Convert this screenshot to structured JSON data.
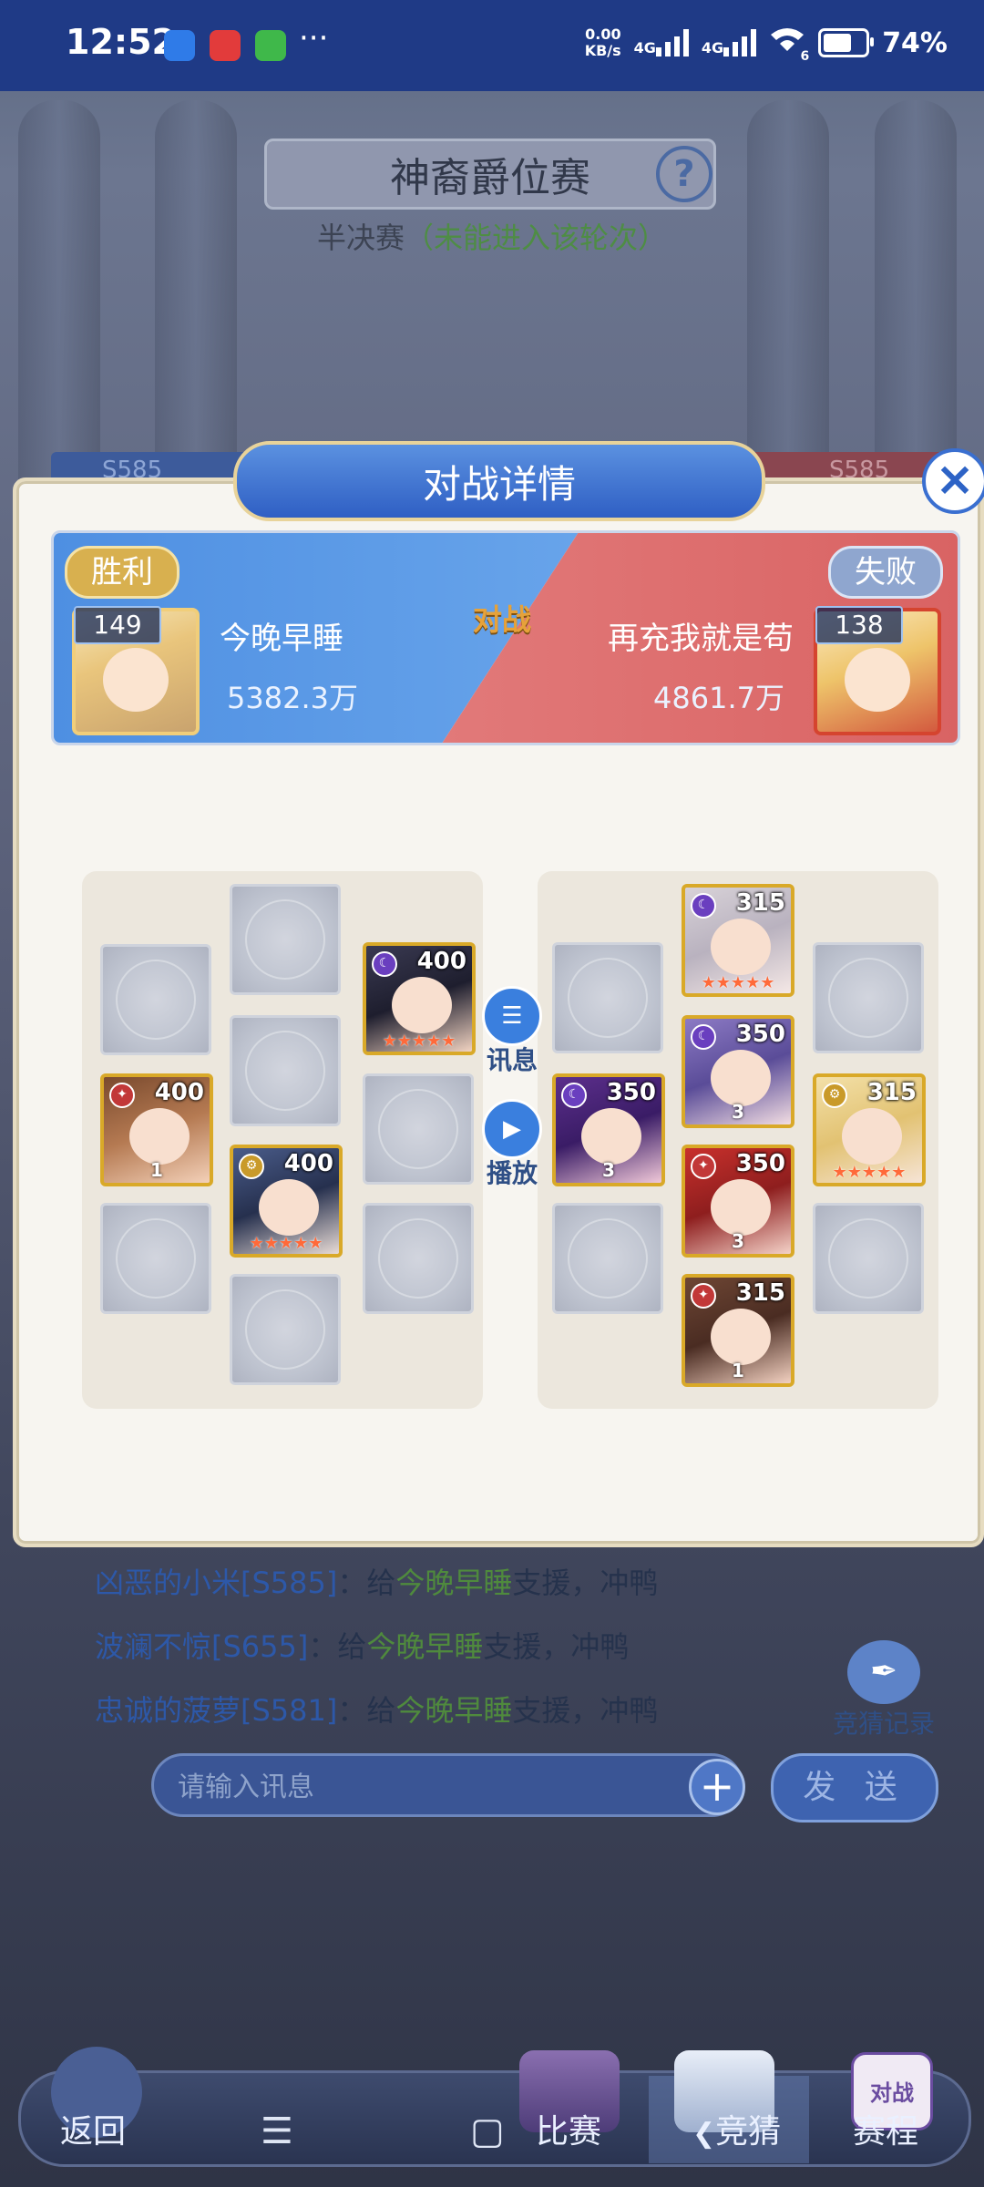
{
  "status_bar": {
    "time": "12:52",
    "net_speed_value": "0.00",
    "net_speed_unit": "KB/s",
    "network_1": "4G",
    "network_2": "4G",
    "wifi_label": "6",
    "battery": "74%"
  },
  "page": {
    "title": "神裔爵位赛",
    "help_icon": "?",
    "subtitle_prefix": "半决赛",
    "subtitle_note": "（未能进入该轮次）",
    "bg_left_server": "S585",
    "bg_right_server": "S585"
  },
  "modal": {
    "title": "对战详情",
    "close_icon": "×",
    "vs_label": "对战",
    "left_player": {
      "result": "胜利",
      "level": "149",
      "name": "今晚早睡",
      "power": "5382.3万"
    },
    "right_player": {
      "result": "失败",
      "level": "138",
      "name": "再充我就是苟",
      "power": "4861.7万"
    },
    "left_heroes": [
      {
        "level": "400",
        "element": "☾",
        "stars": "★★★★★",
        "rank": ""
      },
      {
        "level": "400",
        "element": "✦",
        "stars": "",
        "rank": "1"
      },
      {
        "level": "400",
        "element": "⚙",
        "stars": "★★★★★",
        "rank": ""
      }
    ],
    "right_heroes": [
      {
        "level": "315",
        "element": "☾",
        "stars": "★★★★★",
        "rank": ""
      },
      {
        "level": "350",
        "element": "☾",
        "stars": "",
        "rank": "3"
      },
      {
        "level": "350",
        "element": "☾",
        "stars": "",
        "rank": "3"
      },
      {
        "level": "315",
        "element": "⚙",
        "stars": "★★★★★",
        "rank": ""
      },
      {
        "level": "350",
        "element": "✦",
        "stars": "",
        "rank": "3"
      },
      {
        "level": "315",
        "element": "✦",
        "stars": "",
        "rank": "1"
      }
    ],
    "message_button": "讯息",
    "replay_button": "播放"
  },
  "chat": {
    "messages": [
      {
        "user": "凶恶的小米[S585]",
        "sep": "：给",
        "target": "今晚早睡",
        "text": "支援，冲鸭"
      },
      {
        "user": "波澜不惊[S655]",
        "sep": "：给",
        "target": "今晚早睡",
        "text": "支援，冲鸭"
      },
      {
        "user": "忠诚的菠萝[S581]",
        "sep": "：给",
        "target": "今晚早睡",
        "text": "支援，冲鸭"
      }
    ],
    "guess_record": "竞猜记录",
    "input_placeholder": "请输入讯息",
    "send_button": "发 送"
  },
  "bottom_nav": {
    "back": "返回",
    "match": "比赛",
    "guess": "竞猜",
    "schedule": "赛程",
    "schedule_icon_text": "对战"
  },
  "colors": {
    "accent_blue": "#2f5fc4",
    "win_gold": "#d8b04f",
    "lose_blue": "#8fa6cf",
    "highlight_green": "#4f8a3d"
  }
}
